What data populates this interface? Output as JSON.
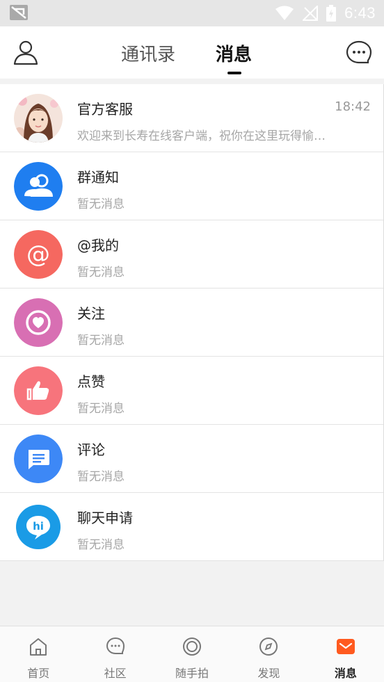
{
  "status_bar": {
    "time": "6:43"
  },
  "header": {
    "tabs": [
      {
        "label": "通讯录"
      },
      {
        "label": "消息"
      }
    ]
  },
  "messages": [
    {
      "title": "官方客服",
      "subtitle": "欢迎来到长寿在线客户端，祝你在这里玩得愉…",
      "time": "18:42",
      "icon": "customer-service-avatar"
    },
    {
      "title": "群通知",
      "subtitle": "暂无消息",
      "icon": "group-icon",
      "color": "#1f7ef0"
    },
    {
      "title": "@我的",
      "subtitle": "暂无消息",
      "icon": "at-icon",
      "color": "#f56860"
    },
    {
      "title": "关注",
      "subtitle": "暂无消息",
      "icon": "heart-icon",
      "color": "#d86fb3"
    },
    {
      "title": "点赞",
      "subtitle": "暂无消息",
      "icon": "thumbs-up-icon",
      "color": "#f7747c"
    },
    {
      "title": "评论",
      "subtitle": "暂无消息",
      "icon": "comment-icon",
      "color": "#3d88f6"
    },
    {
      "title": "聊天申请",
      "subtitle": "暂无消息",
      "icon": "hi-chat-icon",
      "color": "#1a9be6"
    }
  ],
  "bottom_nav": {
    "items": [
      {
        "label": "首页",
        "icon": "home-icon"
      },
      {
        "label": "社区",
        "icon": "community-icon"
      },
      {
        "label": "随手拍",
        "icon": "camera-icon"
      },
      {
        "label": "发现",
        "icon": "compass-icon"
      },
      {
        "label": "消息",
        "icon": "mail-icon",
        "active": true
      }
    ],
    "active_color": "#ff5a1f"
  }
}
